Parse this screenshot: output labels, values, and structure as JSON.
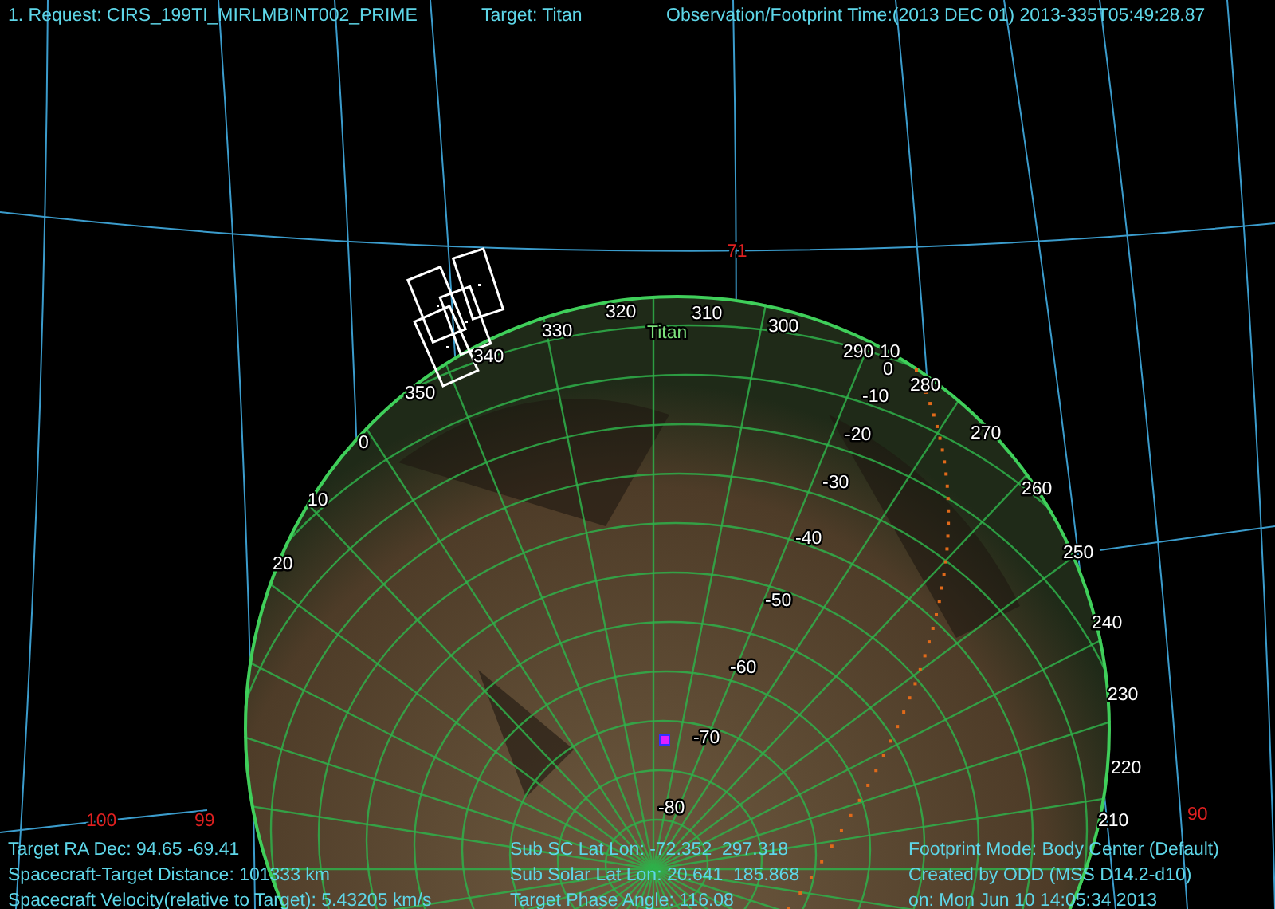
{
  "header": {
    "request": "1. Request: CIRS_199TI_MIRLMBINT002_PRIME",
    "target": "Target: Titan",
    "time": "Observation/Footprint Time:(2013 DEC 01) 2013-335T05:49:28.87"
  },
  "map": {
    "target_label": "Titan",
    "longitude_labels": [
      "20",
      "10",
      "0",
      "350",
      "340",
      "330",
      "320",
      "310",
      "300",
      "290",
      "280",
      "270",
      "260",
      "250",
      "240",
      "230",
      "220",
      "210"
    ],
    "latitude_labels": [
      "10",
      "0",
      "-10",
      "-20",
      "-30",
      "-40",
      "-50",
      "-60",
      "-70",
      "-80"
    ],
    "grid_labels": [
      "71",
      "100",
      "99",
      "90"
    ]
  },
  "footer": {
    "left": [
      "Target RA Dec: 94.65 -69.41",
      "Spacecraft-Target Distance: 101333 km",
      "Spacecraft Velocity(relative to Target): 5.43205 km/s"
    ],
    "middle": [
      "Sub SC Lat Lon: -72.352  297.318",
      "Sub Solar Lat Lon: 20.641  185.868",
      "Target Phase Angle: 116.08"
    ],
    "right": [
      "Footprint Mode: Body Center (Default)",
      "Created by ODD (MSS D14.2-d10)",
      "on: Mon Jun 10 14:05:34 2013"
    ]
  }
}
